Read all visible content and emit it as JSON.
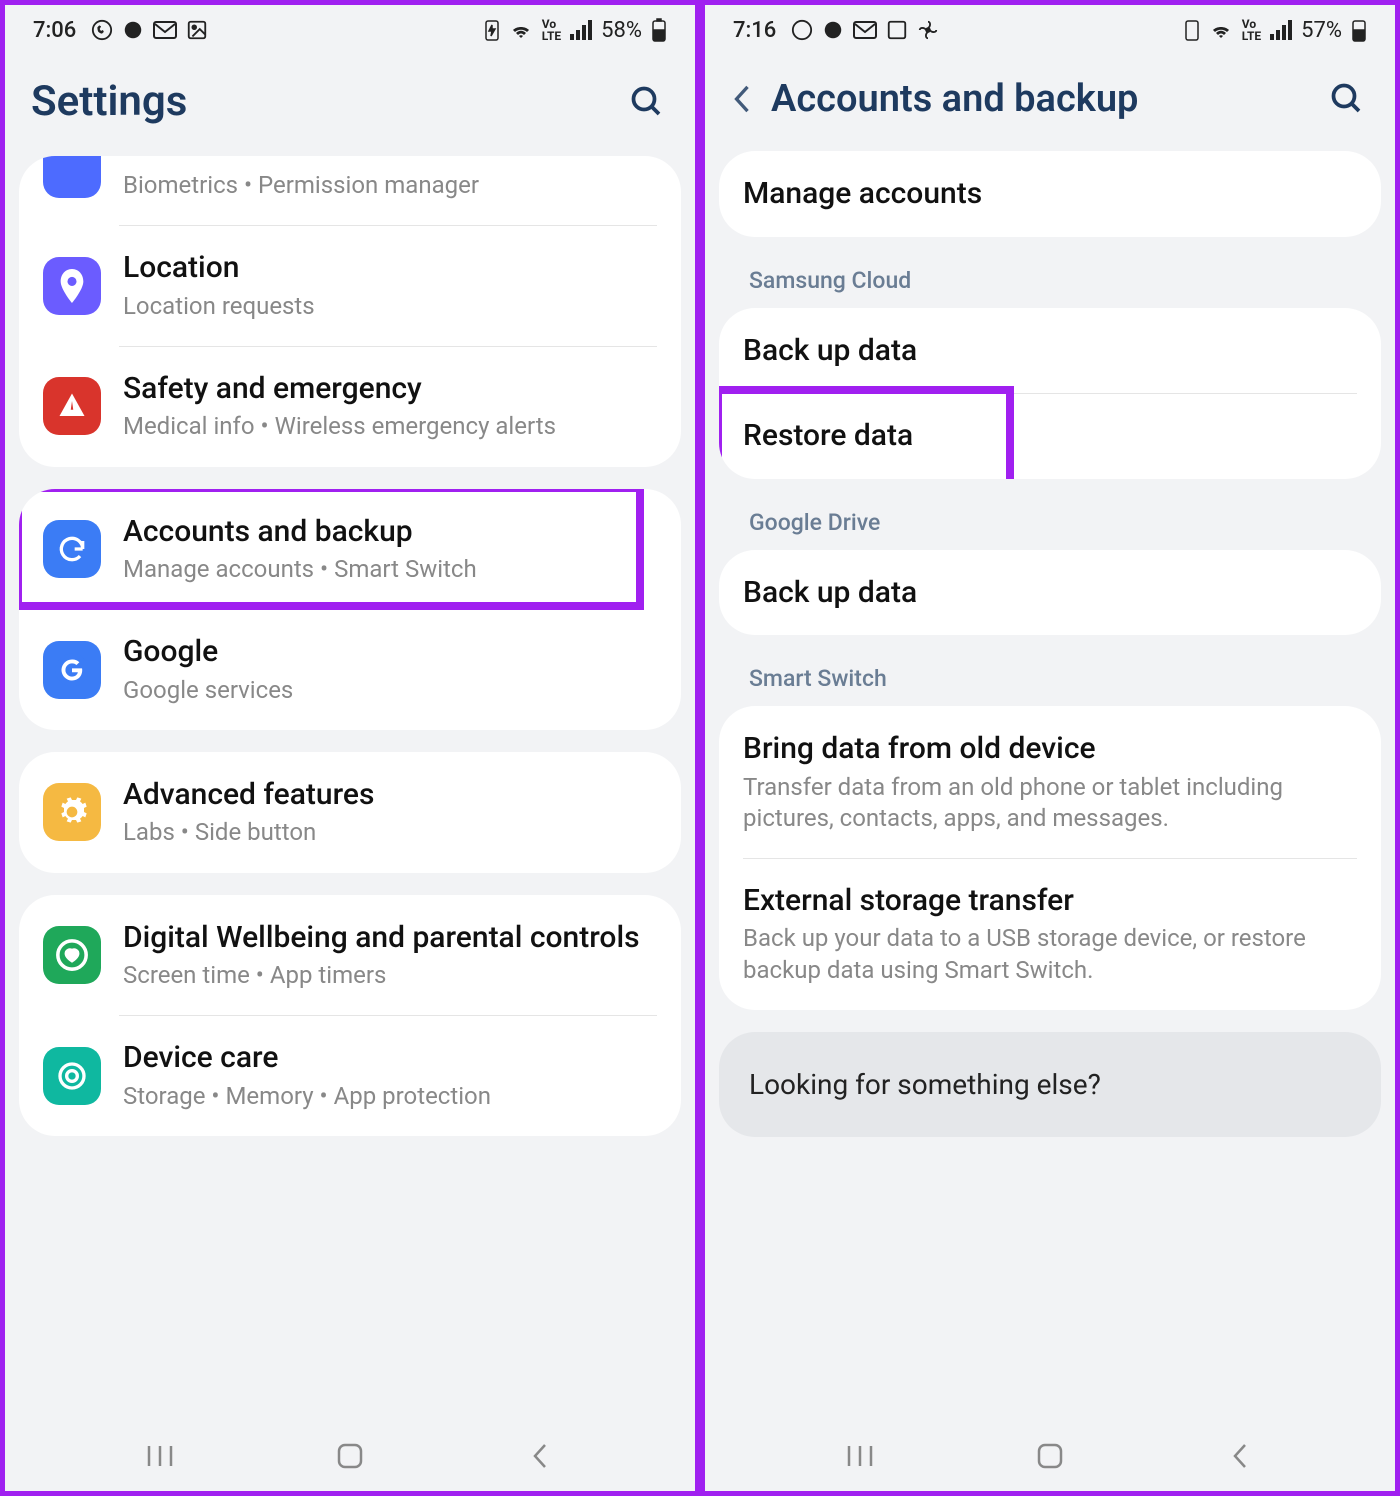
{
  "left": {
    "status": {
      "time": "7:06",
      "battery": "58%"
    },
    "title": "Settings",
    "rows": [
      {
        "id": "biometrics",
        "title": "",
        "sub": "Biometrics  •  Permission manager",
        "icon": "shield",
        "bg": "bg-blue"
      },
      {
        "id": "location",
        "title": "Location",
        "sub": "Location requests",
        "icon": "pin",
        "bg": "bg-purple"
      },
      {
        "id": "safety",
        "title": "Safety and emergency",
        "sub": "Medical info  •  Wireless emergency alerts",
        "icon": "alert",
        "bg": "bg-red"
      },
      {
        "id": "accounts",
        "title": "Accounts and backup",
        "sub": "Manage accounts  •  Smart Switch",
        "icon": "sync",
        "bg": "bg-cyan",
        "highlight": true
      },
      {
        "id": "google",
        "title": "Google",
        "sub": "Google services",
        "icon": "google",
        "bg": "bg-google"
      },
      {
        "id": "advanced",
        "title": "Advanced features",
        "sub": "Labs  •  Side button",
        "icon": "gear",
        "bg": "bg-yellow"
      },
      {
        "id": "wellbeing",
        "title": "Digital Wellbeing and parental controls",
        "sub": "Screen time  •  App timers",
        "icon": "heart-circle",
        "bg": "bg-green"
      },
      {
        "id": "devicecare",
        "title": "Device care",
        "sub": "Storage  •  Memory  •  App protection",
        "icon": "device",
        "bg": "bg-teal"
      }
    ]
  },
  "right": {
    "status": {
      "time": "7:16",
      "battery": "57%"
    },
    "title": "Accounts and backup",
    "sections": [
      {
        "label": "",
        "items": [
          {
            "id": "manage",
            "title": "Manage accounts"
          }
        ]
      },
      {
        "label": "Samsung Cloud",
        "items": [
          {
            "id": "backup-sc",
            "title": "Back up data"
          },
          {
            "id": "restore",
            "title": "Restore data",
            "highlight": true
          }
        ]
      },
      {
        "label": "Google Drive",
        "items": [
          {
            "id": "backup-gd",
            "title": "Back up data"
          }
        ]
      },
      {
        "label": "Smart Switch",
        "items": [
          {
            "id": "bring",
            "title": "Bring data from old device",
            "sub": "Transfer data from an old phone or tablet including pictures, contacts, apps, and messages."
          },
          {
            "id": "external",
            "title": "External storage transfer",
            "sub": "Back up your data to a USB storage device, or restore backup data using Smart Switch."
          }
        ]
      }
    ],
    "footer": "Looking for something else?"
  }
}
